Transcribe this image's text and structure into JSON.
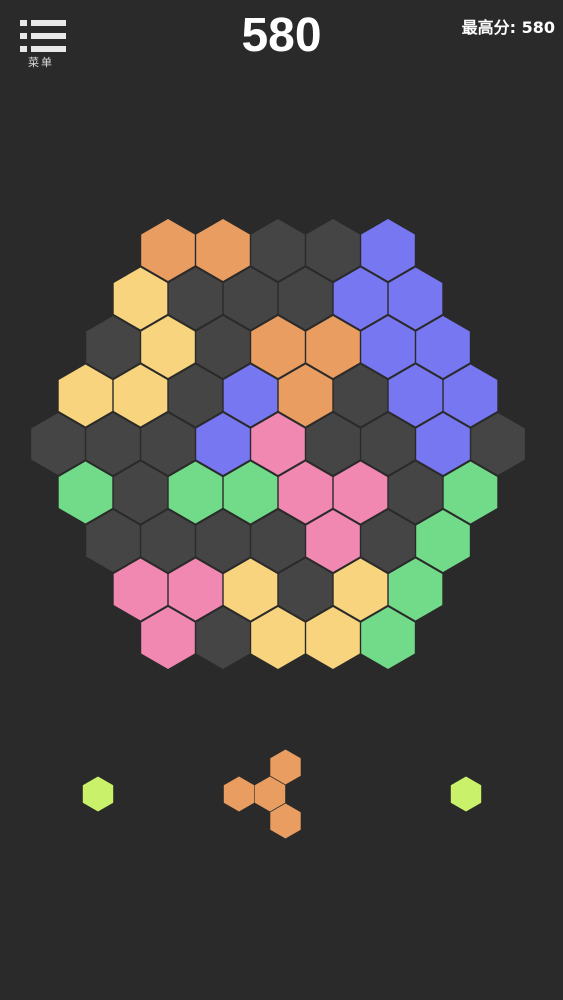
{
  "header": {
    "menu_label": "菜单",
    "score": "580",
    "best_label": "最高分:",
    "best_value": "580"
  },
  "colors": {
    "empty": "#454545",
    "orange": "#e99d61",
    "yellow": "#f9d47e",
    "purple": "#7777f2",
    "pink": "#f088b2",
    "green": "#72db8a",
    "lime": "#c9f26a"
  },
  "board": {
    "rows": [
      [
        "orange",
        "orange",
        "empty",
        "empty",
        "purple"
      ],
      [
        "yellow",
        "empty",
        "empty",
        "empty",
        "purple",
        "purple"
      ],
      [
        "empty",
        "yellow",
        "empty",
        "orange",
        "orange",
        "purple",
        "purple"
      ],
      [
        "yellow",
        "yellow",
        "empty",
        "purple",
        "orange",
        "empty",
        "purple",
        "purple"
      ],
      [
        "empty",
        "empty",
        "empty",
        "purple",
        "pink",
        "empty",
        "empty",
        "purple",
        "empty"
      ],
      [
        "green",
        "empty",
        "green",
        "green",
        "pink",
        "pink",
        "empty",
        "green"
      ],
      [
        "empty",
        "empty",
        "empty",
        "empty",
        "pink",
        "empty",
        "green"
      ],
      [
        "pink",
        "pink",
        "yellow",
        "empty",
        "yellow",
        "green"
      ],
      [
        "pink",
        "empty",
        "yellow",
        "yellow",
        "green"
      ]
    ]
  },
  "pieces": [
    {
      "name": "piece-single-left",
      "color": "lime",
      "cells": [
        [
          0,
          0
        ]
      ]
    },
    {
      "name": "piece-triangle-center",
      "color": "orange",
      "cells": [
        [
          -1,
          0
        ],
        [
          0,
          0
        ],
        [
          1,
          -1
        ],
        [
          0,
          1
        ]
      ]
    },
    {
      "name": "piece-single-right",
      "color": "lime",
      "cells": [
        [
          0,
          0
        ]
      ]
    }
  ]
}
